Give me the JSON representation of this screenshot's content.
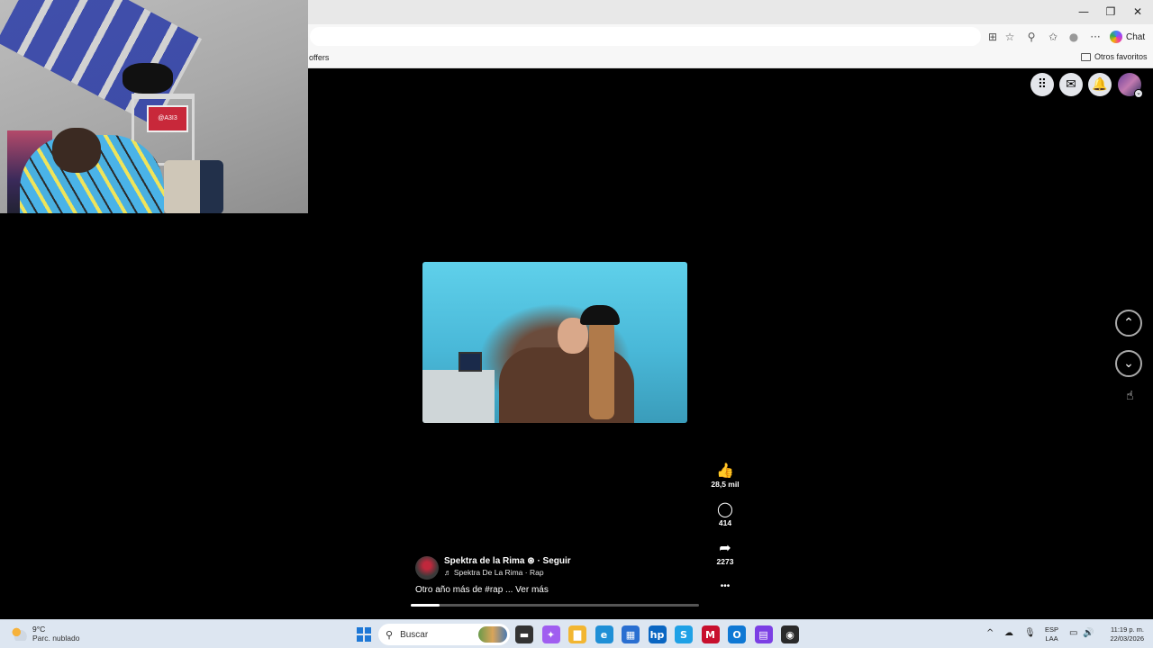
{
  "browser": {
    "window_controls": {
      "minimize": "—",
      "maximize": "❐",
      "close": "✕"
    },
    "toolbar_icons": [
      "app-icon",
      "star-icon",
      "extensions-icon",
      "favorites-icon",
      "profile-icon",
      "more-icon"
    ],
    "toolbar_glyphs": [
      "⊞",
      "☆",
      "⚲",
      "✩",
      "●",
      "···"
    ],
    "chat_label": "Chat",
    "favorites": {
      "left_item": "offers",
      "right_item": "Otros favoritos"
    }
  },
  "facebook": {
    "top_icons": [
      "menu-grid-icon",
      "messenger-icon",
      "notifications-icon"
    ],
    "top_glyphs": [
      "⠿",
      "✉",
      "🔔"
    ],
    "avatar_badge": "⌄",
    "reactions": {
      "like": {
        "icon": "👍",
        "count": "28,5 mil"
      },
      "comment": {
        "icon": "◯",
        "count": "414"
      },
      "share": {
        "icon": "➦",
        "count": "2273"
      },
      "more": "•••"
    },
    "author": {
      "name": "Spektra de la Rima",
      "verified": "⊛",
      "follow": "· Seguir",
      "song": "♬ Spektra De La Rima · Rap"
    },
    "caption": "Otro año más de #rap ... Ver más",
    "progress_fraction": 0.1,
    "nav": {
      "up": "⌃",
      "down": "⌄"
    },
    "cursor": "☝"
  },
  "webcam": {
    "sign_text": "@A3I3"
  },
  "taskbar": {
    "weather": {
      "temp": "9°C",
      "desc": "Parc. nublado"
    },
    "search_placeholder": "Buscar",
    "apps": [
      {
        "name": "file-explorer-icon",
        "glyph": "▬",
        "color": "#333333"
      },
      {
        "name": "copilot-icon",
        "glyph": "✦",
        "color": "#a05ef0"
      },
      {
        "name": "folder-icon",
        "glyph": "▇",
        "color": "#f2b632"
      },
      {
        "name": "edge-icon",
        "glyph": "e",
        "color": "#1f8fd6"
      },
      {
        "name": "store-icon",
        "glyph": "▦",
        "color": "#2a6fd1"
      },
      {
        "name": "hp-icon",
        "glyph": "hp",
        "color": "#0a66c2"
      },
      {
        "name": "skype-icon",
        "glyph": "S",
        "color": "#1fa1e6"
      },
      {
        "name": "mcafee-icon",
        "glyph": "M",
        "color": "#c8102e"
      },
      {
        "name": "outlook-icon",
        "glyph": "O",
        "color": "#0f78d4"
      },
      {
        "name": "clipchamp-icon",
        "glyph": "▤",
        "color": "#7b3fe4"
      },
      {
        "name": "app-red-dot-icon",
        "glyph": "◉",
        "color": "#2a2a2a"
      }
    ],
    "tray": {
      "chevron": "^",
      "network": "☁",
      "mic": "🎙",
      "lang_top": "ESP",
      "lang_bottom": "LAA",
      "display": "▭",
      "volume": "🔊",
      "time": "11:19 p. m.",
      "date": "22/03/2026"
    }
  }
}
